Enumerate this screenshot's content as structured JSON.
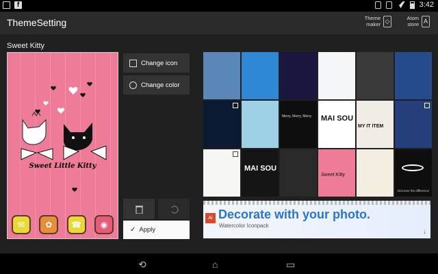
{
  "status_bar": {
    "left_icons": [
      "notification-icon",
      "facebook-icon"
    ],
    "facebook_glyph": "f",
    "right_icons": [
      "vibrate-icon",
      "bluetooth-icon",
      "wifi-icon",
      "battery-icon"
    ],
    "time": "3:42"
  },
  "action_bar": {
    "title": "ThemeSetting",
    "theme_maker_label": "Theme maker",
    "atom_store_label": "Atom store"
  },
  "theme": {
    "name": "Sweet Kitty",
    "preview_text": "Sweet Little Kitty"
  },
  "side_panel": {
    "change_icon_label": "Change icon",
    "change_color_label": "Change color",
    "apply_label": "Apply"
  },
  "gallery": {
    "thumbnails": [
      {
        "name": "thumb-1",
        "bg": "#5a86b8"
      },
      {
        "name": "thumb-2",
        "bg": "#2e88d6"
      },
      {
        "name": "thumb-3",
        "bg": "#1b1640"
      },
      {
        "name": "thumb-4",
        "bg": "#f4f6f7"
      },
      {
        "name": "thumb-5",
        "bg": "#3a3a3a"
      },
      {
        "name": "thumb-6",
        "bg": "#264b8c"
      },
      {
        "name": "thumb-7",
        "bg": "#0b1a33"
      },
      {
        "name": "thumb-8",
        "bg": "#9ed1e6"
      },
      {
        "name": "thumb-9",
        "bg": "#0e0e0e"
      },
      {
        "name": "thumb-10",
        "bg": "#ffffff"
      },
      {
        "name": "thumb-11",
        "bg": "#f0ece6"
      },
      {
        "name": "thumb-12",
        "bg": "#243f7a"
      },
      {
        "name": "thumb-13",
        "bg": "#f6f6f4"
      },
      {
        "name": "thumb-14",
        "bg": "#151515"
      },
      {
        "name": "thumb-15",
        "bg": "#2a2a2a"
      },
      {
        "name": "thumb-16",
        "bg": "#ee7b97"
      },
      {
        "name": "thumb-17",
        "bg": "#f3eedf"
      },
      {
        "name": "thumb-18",
        "bg": "#0e0e0e"
      }
    ],
    "thumb_texts": {
      "t9": "Merry, Merry, Merry",
      "t10": "MAI SOU",
      "t11": "MY IT ITEM",
      "t14": "MAI SOU",
      "t16": "Sweet Kitty",
      "t18": "Discover the difference"
    }
  },
  "banner": {
    "title": "Decorate with your photo.",
    "subtitle": "Watercolor Iconpack",
    "badge": "Ai"
  },
  "colors": {
    "pink": "#ee7b97",
    "accent_blue": "#2b73d6"
  }
}
